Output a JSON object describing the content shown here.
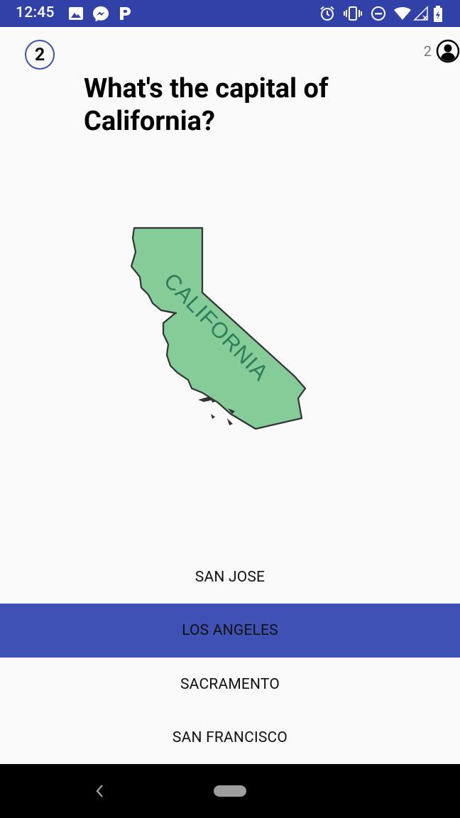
{
  "status_bar": {
    "time": "12:45",
    "left_icons": [
      "image-icon",
      "messenger-icon",
      "parking-icon"
    ],
    "right_icons": [
      "alarm-icon",
      "vibrate-icon",
      "do-not-disturb-icon",
      "wifi-icon",
      "signal-icon",
      "battery-icon"
    ]
  },
  "header": {
    "question_number": "2",
    "score": "2"
  },
  "question": {
    "text": "What's the capital of California?"
  },
  "map": {
    "label": "CALIFORNIA",
    "fill_color": "#85cc99"
  },
  "answers": [
    {
      "label": "SAN JOSE",
      "selected": false
    },
    {
      "label": "LOS ANGELES",
      "selected": true
    },
    {
      "label": "SACRAMENTO",
      "selected": false
    },
    {
      "label": "SAN FRANCISCO",
      "selected": false
    }
  ],
  "colors": {
    "accent": "#3f51b5",
    "status_bar": "#3141a8",
    "background": "#fafafa"
  }
}
